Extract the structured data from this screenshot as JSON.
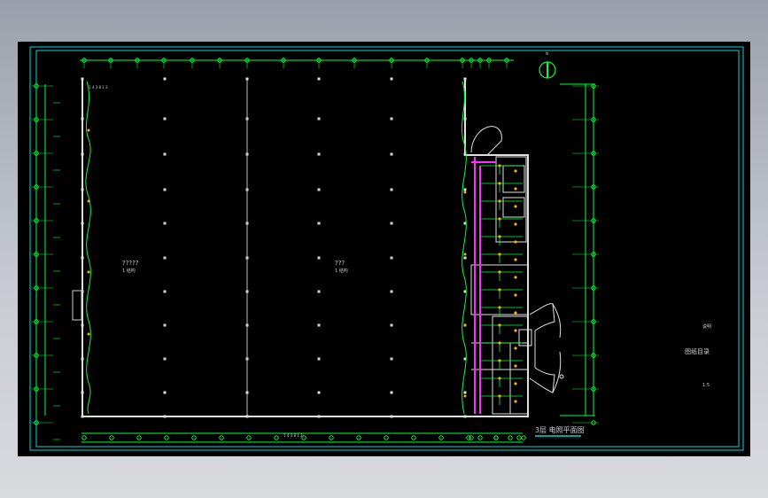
{
  "drawing": {
    "title": "3层 电照平面图",
    "side_note_top": "说明",
    "side_title": "图纸目录",
    "side_note_bottom": "1:5",
    "hall_left_label": "?????",
    "hall_left_sub": "1 结构",
    "hall_right_label": "???",
    "hall_right_sub": "1 结构",
    "north_symbol": "N",
    "top_annotation": "1 4 3 8 1 2",
    "bottom_annotation": "1 4 3 8 1 2"
  },
  "colors": {
    "background": "#000000",
    "frame": "#00d7d7",
    "wall": "#e0e0e0",
    "axis": "#00ff3c",
    "wire": "#ff2bff",
    "fixture": "#ffb000",
    "cable_tray": "#4fd0ff"
  }
}
